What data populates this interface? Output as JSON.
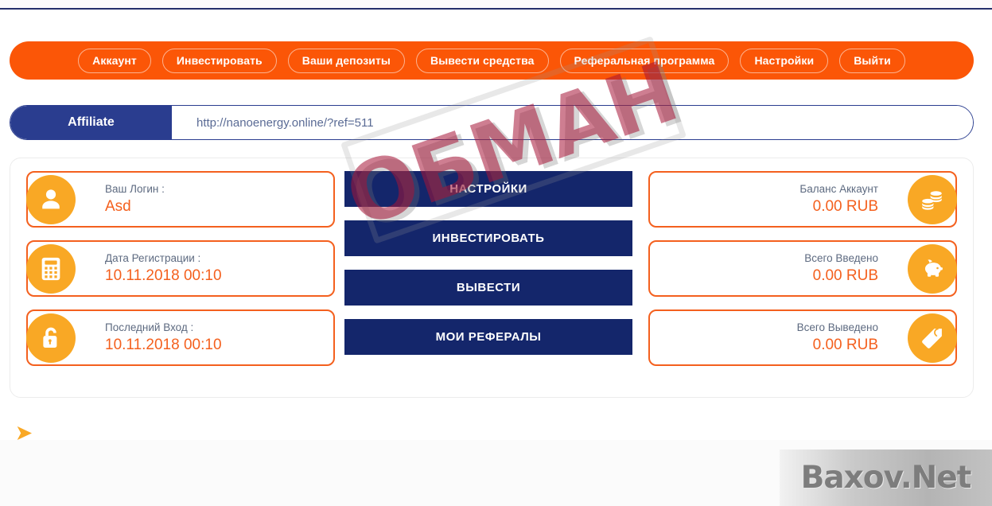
{
  "nav": {
    "items": [
      {
        "label": "Аккаунт",
        "name": "nav-account"
      },
      {
        "label": "Инвестировать",
        "name": "nav-invest"
      },
      {
        "label": "Ваши депозиты",
        "name": "nav-deposits"
      },
      {
        "label": "Вывести средства",
        "name": "nav-withdraw"
      },
      {
        "label": "Реферальная программа",
        "name": "nav-referral"
      },
      {
        "label": "Настройки",
        "name": "nav-settings"
      },
      {
        "label": "Выйти",
        "name": "nav-logout"
      }
    ]
  },
  "affiliate": {
    "label": "Affiliate",
    "url": "http://nanoenergy.online/?ref=511"
  },
  "left_cards": [
    {
      "icon": "user-icon",
      "label": "Ваш Логин :",
      "value": "Asd"
    },
    {
      "icon": "calculator-icon",
      "label": "Дата Регистрации :",
      "value": "10.11.2018 00:10"
    },
    {
      "icon": "unlock-icon",
      "label": "Последний Вход :",
      "value": "10.11.2018 00:10"
    }
  ],
  "center_buttons": [
    {
      "label": "НАСТРОЙКИ",
      "name": "settings-button"
    },
    {
      "label": "ИНВЕСТИРОВАТЬ",
      "name": "invest-button"
    },
    {
      "label": "ВЫВЕСТИ",
      "name": "withdraw-button"
    },
    {
      "label": "МОИ РЕФЕРАЛЫ",
      "name": "my-referrals-button"
    }
  ],
  "right_cards": [
    {
      "icon": "coins-icon",
      "label": "Баланс Аккаунт",
      "value": "0.00 RUB"
    },
    {
      "icon": "piggy-bank-icon",
      "label": "Всего Введено",
      "value": "0.00 RUB"
    },
    {
      "icon": "price-tag-icon",
      "label": "Всего Выведено",
      "value": "0.00 RUB"
    }
  ],
  "watermark": {
    "stamp_text": "ОБМАН",
    "footer_text": "Baxov.Net"
  },
  "colors": {
    "orange_nav": "#fb5607",
    "orange_accent": "#f4601e",
    "orange_icon": "#f9a825",
    "navy": "#14266b",
    "navy_affiliate": "#2a3d8f",
    "label_gray": "#5d6a80",
    "stamp_red": "#a51437"
  }
}
